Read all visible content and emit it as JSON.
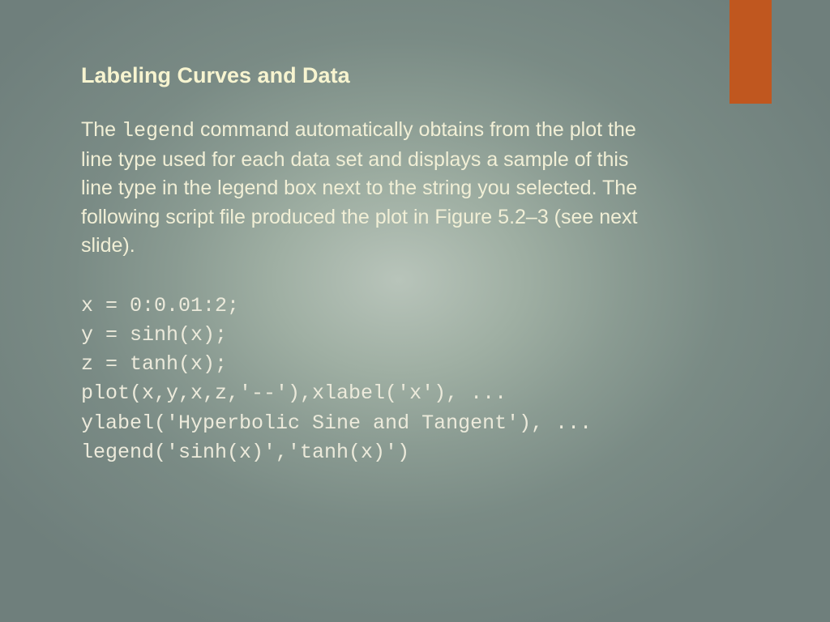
{
  "slide": {
    "title": "Labeling Curves and Data",
    "paragraph_pre": "The ",
    "paragraph_cmd": "legend",
    "paragraph_post": " command automatically obtains from the plot the line type used for each data set and displays a sample of this line type in the legend box next to the string you selected. The following script file produced the plot in Figure 5.2–3 (see next slide).",
    "code": "x = 0:0.01:2;\ny = sinh(x);\nz = tanh(x);\nplot(x,y,x,z,'--'),xlabel('x'), ...\nylabel('Hyperbolic Sine and Tangent'), ...\nlegend('sinh(x)','tanh(x)')"
  }
}
